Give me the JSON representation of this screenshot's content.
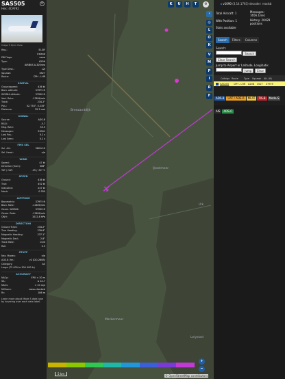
{
  "aircraft": {
    "callsign": "SAS505",
    "hex": "Hex: 4CAF92",
    "photo_credit": "Image © Björn Huke",
    "reg_label": "Reg.:",
    "reg": "EI-SIF",
    "country": "Ireland",
    "db_flags_label": "DB Flags:",
    "db_flags": "none",
    "type_label": "Type:",
    "type": "A20N",
    "type_full": "AIRBUS A-320neo",
    "type_desc_label": "Type Desc.:",
    "type_desc": "L2J",
    "squawk_label": "Squawk:",
    "squawk": "3527",
    "route_label": "Route:",
    "route": "CPH - LHR"
  },
  "sections": [
    {
      "title": "SPATIAL",
      "rows": [
        [
          "Groundspeed:",
          "436 kt"
        ],
        [
          "Baro. altitude:",
          "37975 ft"
        ],
        [
          "WGS84 altitude:",
          "37200 ft"
        ],
        [
          "Vert. Rate:",
          "-128 ft/min"
        ],
        [
          "Track:",
          "234.2°"
        ],
        [
          "Pos.:",
          "52.778°, 5.235°"
        ],
        [
          "Distance:",
          "35.3 nmi"
        ]
      ]
    },
    {
      "title": "SIGNAL",
      "rows": [
        [
          "Source:",
          "ADS-B"
        ],
        [
          "RSSI:",
          "-5.7"
        ],
        [
          "Msg. Rate:",
          "55.5"
        ],
        [
          "Messages:",
          "53041"
        ],
        [
          "",
          ""
        ],
        [
          "Last Pos.:",
          "0.2 s"
        ],
        [
          "Last Seen:",
          "0.2 s"
        ]
      ]
    },
    {
      "title": "FMS SEL",
      "rows": [
        [
          "Sel. Alt.:",
          "38016 ft"
        ],
        [
          "Sel. Head.:",
          "n/a"
        ]
      ]
    },
    {
      "title": "WIND",
      "rows": [
        [
          "Speed:",
          "47 kt"
        ],
        [
          "Direction (from):",
          "308°"
        ],
        [
          "TAT / OAT:",
          "-25 / -52 °C"
        ]
      ]
    },
    {
      "title": "SPEED",
      "rows": [
        [
          "Ground:",
          "436 kt"
        ],
        [
          "True:",
          "452 kt"
        ],
        [
          "Indicated:",
          "247 kt"
        ],
        [
          "Mach:",
          "0.780"
        ]
      ]
    },
    {
      "title": "ALTITUDE",
      "rows": [
        [
          "Barometric:",
          "37975 ft"
        ],
        [
          "Baro. Rate:",
          "-128 ft/min"
        ],
        [
          "Geom. WGS84:",
          "37200 ft"
        ],
        [
          "Geom. Rate:",
          "-128 ft/min"
        ],
        [
          "QNH:",
          "1012.8 hPa"
        ]
      ]
    },
    {
      "title": "DIRECTION",
      "rows": [
        [
          "Ground Track:",
          "234.2°"
        ],
        [
          "True Heading:",
          "239.6°"
        ],
        [
          "Magnetic Heading:",
          "237.1°"
        ],
        [
          "Magnetic Decl.:",
          "2.8°"
        ],
        [
          "Track Rate:",
          "0.03"
        ],
        [
          "Roll:",
          "0.5"
        ]
      ]
    },
    {
      "title": "STUFF",
      "rows": [
        [
          "Nav. Modes:",
          "n/a"
        ],
        [
          "ADS-B Ver.:",
          "v2 (DO-260B)"
        ],
        [
          "Category:",
          "A3"
        ],
        [
          "Large (75 000 to 300 000 lb)",
          ""
        ]
      ]
    },
    {
      "title": "ACCURACY",
      "rows": [
        [
          "NACp:",
          "EPU < 30 m"
        ],
        [
          "SIL:",
          "≤ 1e-7"
        ],
        [
          "NACv:",
          "< 10 m/s"
        ],
        [
          "NICbaro:",
          "cross-checked"
        ],
        [
          "Rc:",
          "186 m"
        ]
      ]
    }
  ],
  "footer_text": "Learn more about Mode S data type by hovering over each data label.",
  "map": {
    "place_1": "Breezanddijk",
    "place_2": "IJsselmeer",
    "place_3": "Markermeer",
    "place_4": "Lelystad",
    "place_5": "Urk",
    "buttons": [
      "K",
      "U",
      "H",
      "T",
      "L",
      "O",
      "K",
      "V",
      "M",
      "P",
      "I",
      "R",
      "F"
    ],
    "zoom_in": "+",
    "zoom_out": "−",
    "attribution": "© OpenStreetMap contributors",
    "scale_label": "5 km"
  },
  "right": {
    "version": "v1090",
    "version_full": "(3.14.1763)",
    "decoder": "decoder: readsb",
    "total_label": "Total Aircraft: 1",
    "messages_label": "Messages:",
    "messages_val": "1656.1/sec",
    "with_pos_label": "With Position: 1",
    "history_label": "History: 20429 positions",
    "stats_label": "Stats available",
    "tabs": [
      "Search",
      "Filters",
      "Columns"
    ],
    "search_label": "Search:",
    "search_btn": "Search",
    "clear_search": "Clear Search",
    "jump_label": "Jump to Airport or Latitude, Longitude:",
    "jump_btn": "Jump",
    "clear_btn": "Clear",
    "table_headers": [
      "Callsign",
      "Route",
      "Type",
      "Squawk",
      "Alt. (ft)"
    ],
    "table_row": [
      "SAS505",
      "CPH - LHR",
      "A20N",
      "3527",
      "37975"
    ],
    "badges": [
      {
        "label": "ADS-B",
        "color": "#1f5aa8",
        "text": "#fff"
      },
      {
        "label": "UAT / ADS-R",
        "color": "#f0a020",
        "text": "#111"
      },
      {
        "label": "MLAT",
        "color": "#f7c83a",
        "text": "#111"
      },
      {
        "label": "TIS-B",
        "color": "#c3242a",
        "text": "#fff"
      },
      {
        "label": "Mode-S",
        "color": "#4a4a4a",
        "text": "#fff"
      },
      {
        "label": "AIS",
        "color": "#2e2e2e",
        "text": "#fff"
      },
      {
        "label": "ADS-C",
        "color": "#2f8a4a",
        "text": "#fff"
      }
    ]
  },
  "colors": {
    "track": "#c13ad6",
    "water": "#48533f",
    "land": "#3e4436",
    "panel": "#202020",
    "accent": "#2a6aa8"
  }
}
